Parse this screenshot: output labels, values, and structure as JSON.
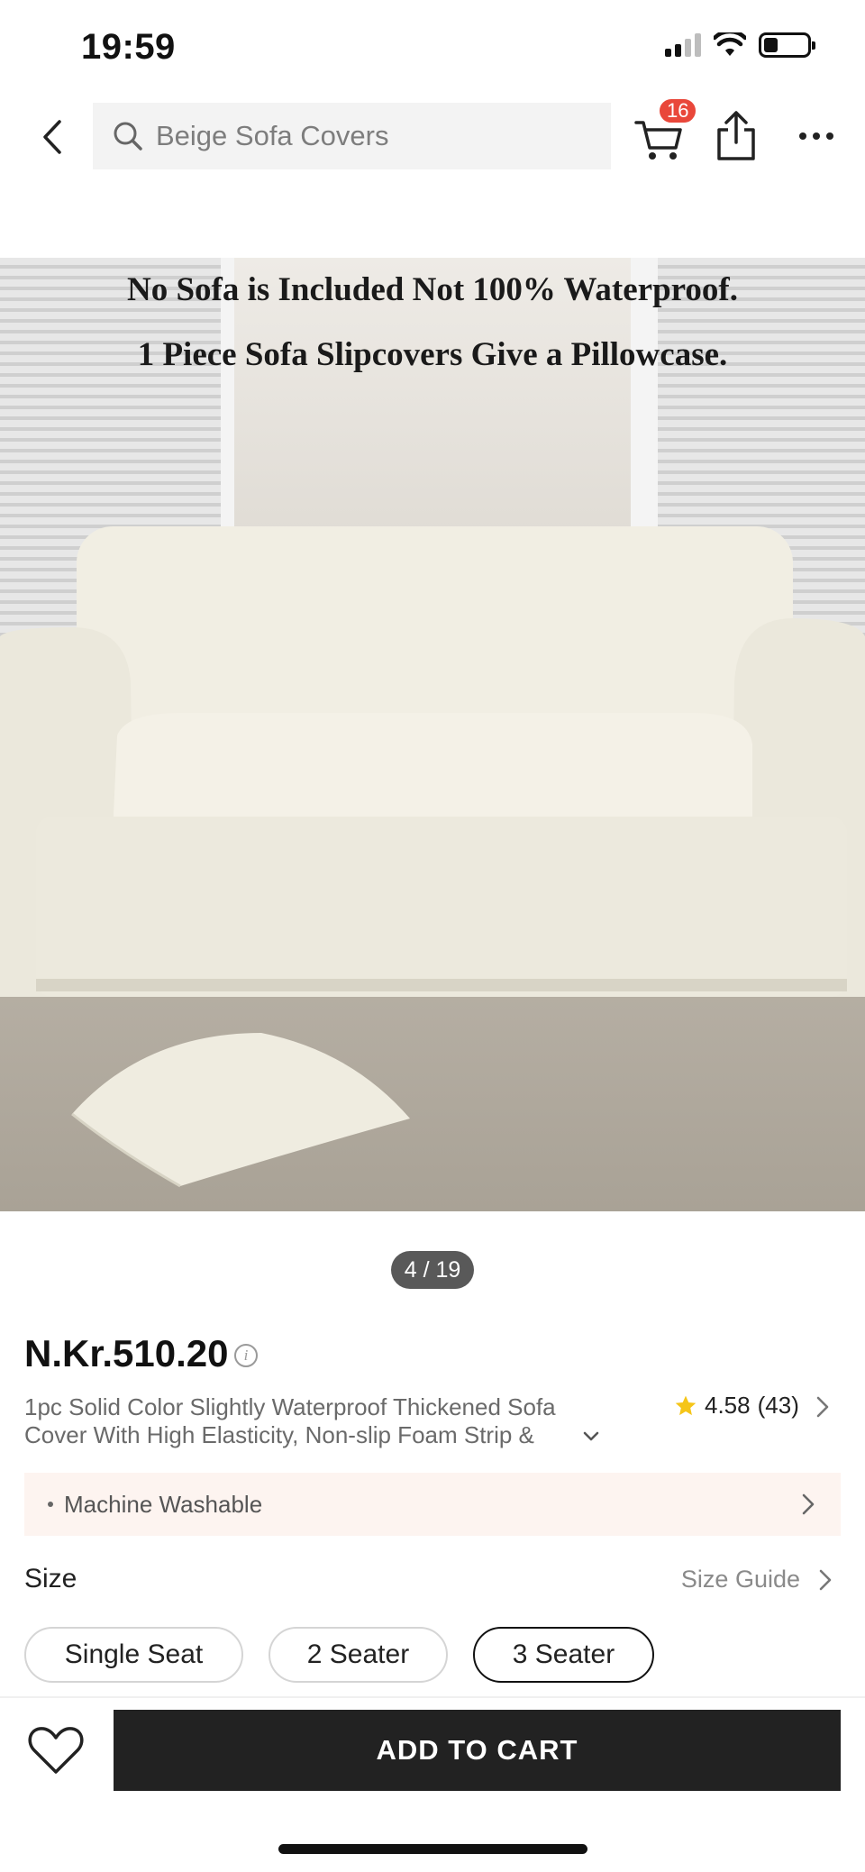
{
  "status_bar": {
    "time": "19:59"
  },
  "nav": {
    "search_text": "Beige Sofa Covers",
    "cart_count": "16"
  },
  "product_image": {
    "caption_line1": "No Sofa is Included Not 100% Waterproof.",
    "caption_line2": "1 Piece Sofa Slipcovers Give a Pillowcase.",
    "page_indicator": "4 / 19",
    "current_image": 4,
    "total_images": 19
  },
  "product": {
    "price": "N.Kr.510.20",
    "title": "1pc Solid Color Slightly Waterproof Thickened Sofa Cover With High Elasticity, Non-slip Foam Strip &",
    "rating": "4.58",
    "review_count": "(43)",
    "feature": "Machine Washable"
  },
  "size": {
    "label": "Size",
    "guide_label": "Size Guide",
    "options": [
      "Single Seat",
      "2 Seater",
      "3 Seater"
    ],
    "selected": "3 Seater"
  },
  "bottom_bar": {
    "add_to_cart_label": "ADD TO CART"
  },
  "colors": {
    "badge": "#e9473a",
    "primary_button": "#222222",
    "feature_bg": "#fdf4f0",
    "star": "#f5c518"
  },
  "icons": {
    "back": "chevron-left-icon",
    "search": "search-icon",
    "cart": "cart-icon",
    "share": "share-icon",
    "more": "more-icon",
    "wishlist": "heart-icon",
    "star": "star-icon"
  }
}
